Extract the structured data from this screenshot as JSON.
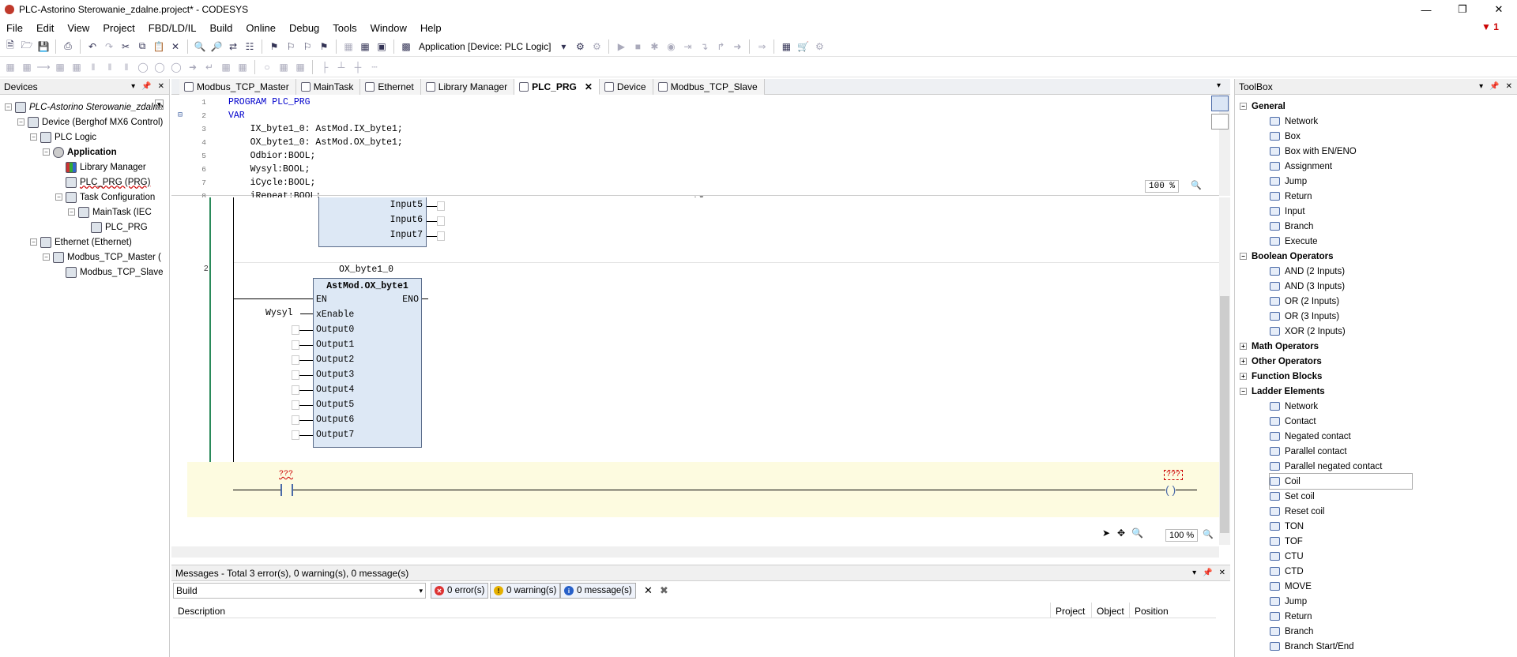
{
  "window": {
    "title": "PLC-Astorino Sterowanie_zdalne.project* - CODESYS",
    "error_count": "1"
  },
  "menu": [
    "File",
    "Edit",
    "View",
    "Project",
    "FBD/LD/IL",
    "Build",
    "Online",
    "Debug",
    "Tools",
    "Window",
    "Help"
  ],
  "toolbar": {
    "application_selector": "Application [Device: PLC Logic]"
  },
  "devices": {
    "title": "Devices",
    "items": [
      {
        "label": "PLC-Astorino Sterowanie_zdalne",
        "level": 0,
        "icon": "project-icon",
        "italic": true
      },
      {
        "label": "Device (Berghof MX6 Control)",
        "level": 1,
        "icon": "device-icon"
      },
      {
        "label": "PLC Logic",
        "level": 2,
        "icon": "plc-logic-icon"
      },
      {
        "label": "Application",
        "level": 3,
        "icon": "application-gear-icon",
        "bold": true
      },
      {
        "label": "Library Manager",
        "level": 4,
        "icon": "library-icon"
      },
      {
        "label": "PLC_PRG (PRG)",
        "level": 4,
        "icon": "program-icon",
        "underline": true
      },
      {
        "label": "Task Configuration",
        "level": 4,
        "icon": "task-config-icon"
      },
      {
        "label": "MainTask (IEC",
        "level": 5,
        "icon": "task-icon"
      },
      {
        "label": "PLC_PRG",
        "level": 6,
        "icon": "program-icon"
      },
      {
        "label": "Ethernet (Ethernet)",
        "level": 2,
        "icon": "ethernet-icon"
      },
      {
        "label": "Modbus_TCP_Master (",
        "level": 3,
        "icon": "modbus-icon"
      },
      {
        "label": "Modbus_TCP_Slave",
        "level": 4,
        "icon": "modbus-icon"
      }
    ]
  },
  "tabs": [
    {
      "label": "Modbus_TCP_Master",
      "icon": "modbus-icon"
    },
    {
      "label": "MainTask",
      "icon": "task-icon"
    },
    {
      "label": "Ethernet",
      "icon": "ethernet-icon"
    },
    {
      "label": "Library Manager",
      "icon": "library-icon"
    },
    {
      "label": "PLC_PRG",
      "icon": "program-icon",
      "active": true
    },
    {
      "label": "Device",
      "icon": "device-icon"
    },
    {
      "label": "Modbus_TCP_Slave",
      "icon": "modbus-icon"
    }
  ],
  "declaration": {
    "lines": [
      {
        "n": "1",
        "text": "PROGRAM PLC_PRG",
        "kw": true
      },
      {
        "n": "2",
        "text": "VAR",
        "kw": true
      },
      {
        "n": "3",
        "text": "    IX_byte1_0: AstMod.IX_byte1;"
      },
      {
        "n": "4",
        "text": "    OX_byte1_0: AstMod.OX_byte1;"
      },
      {
        "n": "5",
        "text": "    Odbior:BOOL;"
      },
      {
        "n": "6",
        "text": "    Wysyl:BOOL;"
      },
      {
        "n": "7",
        "text": "    iCycle:BOOL;"
      },
      {
        "n": "8",
        "text": "    iRepeat:BOOL;"
      }
    ],
    "zoom": "100 %"
  },
  "fbd": {
    "network1_pins": [
      "Input5",
      "Input6",
      "Input7"
    ],
    "network2": {
      "number": "2",
      "instance": "OX_byte1_0",
      "type": "AstMod.OX_byte1",
      "en": "EN",
      "eno": "ENO",
      "xenable": "xEnable",
      "xenable_var": "Wysyl",
      "outputs": [
        "Output0",
        "Output1",
        "Output2",
        "Output3",
        "Output4",
        "Output5",
        "Output6",
        "Output7"
      ]
    },
    "network3": {
      "number": "3",
      "contact_var": "???",
      "coil_var": "???"
    },
    "zoom": "100 %"
  },
  "messages": {
    "title": "Messages - Total 3 error(s), 0 warning(s), 0 message(s)",
    "category": "Build",
    "errors": "0 error(s)",
    "warnings": "0 warning(s)",
    "infos": "0 message(s)",
    "columns": [
      "Description",
      "Project",
      "Object",
      "Position"
    ]
  },
  "toolbox": {
    "title": "ToolBox",
    "items": [
      {
        "label": "General",
        "cat": true,
        "open": true
      },
      {
        "label": "Network"
      },
      {
        "label": "Box"
      },
      {
        "label": "Box with EN/ENO"
      },
      {
        "label": "Assignment"
      },
      {
        "label": "Jump"
      },
      {
        "label": "Return"
      },
      {
        "label": "Input"
      },
      {
        "label": "Branch"
      },
      {
        "label": "Execute"
      },
      {
        "label": "Boolean Operators",
        "cat": true,
        "open": true
      },
      {
        "label": "AND (2 Inputs)"
      },
      {
        "label": "AND (3 Inputs)"
      },
      {
        "label": "OR (2 Inputs)"
      },
      {
        "label": "OR (3 Inputs)"
      },
      {
        "label": "XOR (2 Inputs)"
      },
      {
        "label": "Math Operators",
        "cat": true,
        "open": false
      },
      {
        "label": "Other Operators",
        "cat": true,
        "open": false
      },
      {
        "label": "Function Blocks",
        "cat": true,
        "open": false
      },
      {
        "label": "Ladder Elements",
        "cat": true,
        "open": true
      },
      {
        "label": "Network"
      },
      {
        "label": "Contact"
      },
      {
        "label": "Negated contact"
      },
      {
        "label": "Parallel contact"
      },
      {
        "label": "Parallel negated contact"
      },
      {
        "label": "Coil",
        "selected": true
      },
      {
        "label": "Set coil"
      },
      {
        "label": "Reset coil"
      },
      {
        "label": "TON"
      },
      {
        "label": "TOF"
      },
      {
        "label": "CTU"
      },
      {
        "label": "CTD"
      },
      {
        "label": "MOVE"
      },
      {
        "label": "Jump"
      },
      {
        "label": "Return"
      },
      {
        "label": "Branch"
      },
      {
        "label": "Branch Start/End"
      }
    ]
  }
}
